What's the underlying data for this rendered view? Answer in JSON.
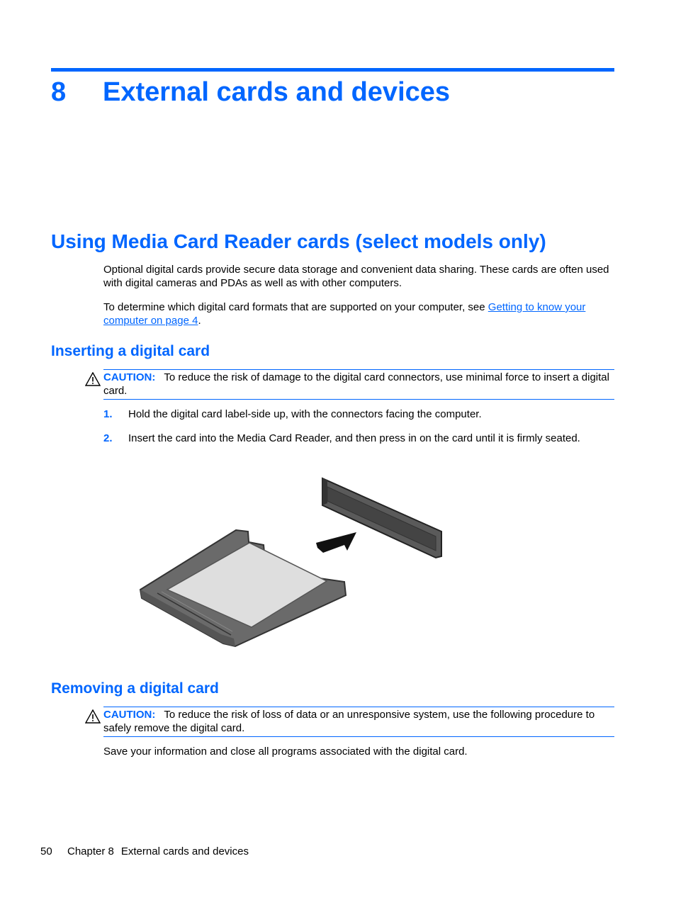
{
  "chapter": {
    "number": "8",
    "title": "External cards and devices"
  },
  "section": {
    "title": "Using Media Card Reader cards (select models only)",
    "intro": "Optional digital cards provide secure data storage and convenient data sharing. These cards are often used with digital cameras and PDAs as well as with other computers.",
    "formats_text": "To determine which digital card formats that are supported on your computer, see ",
    "formats_link": "Getting to know your computer on page 4",
    "formats_end": "."
  },
  "inserting": {
    "title": "Inserting a digital card",
    "caution_label": "CAUTION:",
    "caution_text": "To reduce the risk of damage to the digital card connectors, use minimal force to insert a digital card.",
    "steps": [
      {
        "num": "1.",
        "text": "Hold the digital card label-side up, with the connectors facing the computer."
      },
      {
        "num": "2.",
        "text": "Insert the card into the Media Card Reader, and then press in on the card until it is firmly seated."
      }
    ],
    "figure_icon": "digital-card-insert-illustration"
  },
  "removing": {
    "title": "Removing a digital card",
    "caution_label": "CAUTION:",
    "caution_text": "To reduce the risk of loss of data or an unresponsive system, use the following procedure to safely remove the digital card.",
    "body": "Save your information and close all programs associated with the digital card."
  },
  "footer": {
    "page": "50",
    "chapter": "Chapter 8",
    "title": "External cards and devices"
  },
  "colors": {
    "accent": "#0066ff",
    "text": "#000000"
  }
}
